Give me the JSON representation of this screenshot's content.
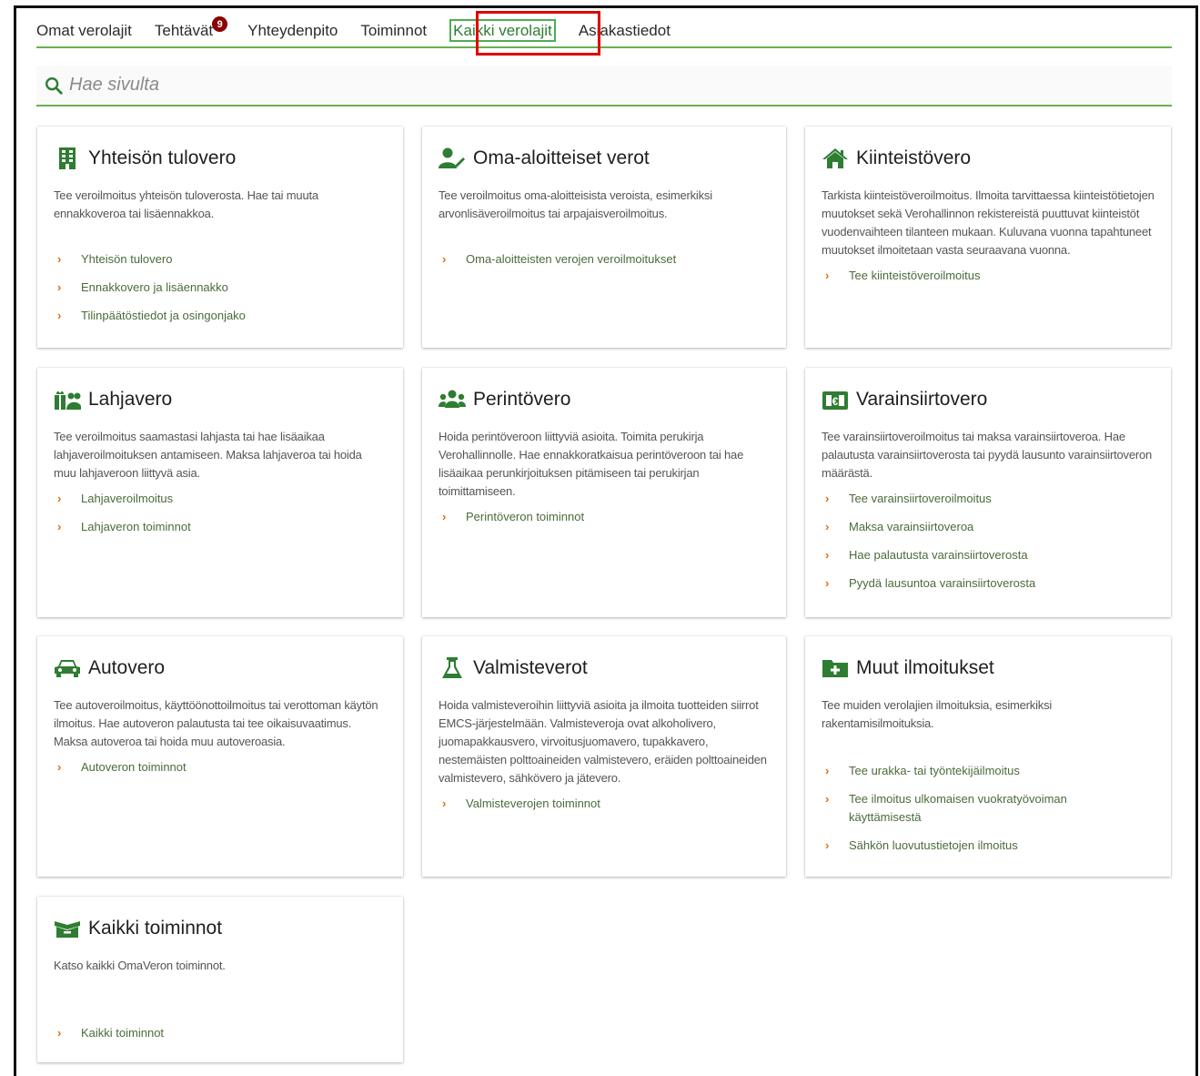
{
  "tabs": [
    {
      "label": "Omat verolajit"
    },
    {
      "label": "Tehtävät",
      "badge": "9"
    },
    {
      "label": "Yhteydenpito"
    },
    {
      "label": "Toiminnot"
    },
    {
      "label": "Kaikki verolajit",
      "active": true
    },
    {
      "label": "Asiakastiedot"
    }
  ],
  "search": {
    "placeholder": "Hae sivulta",
    "icon": "search-icon"
  },
  "colors": {
    "accent": "#6ab04c",
    "link_chevron": "#e06d0c",
    "highlight": "#e00000",
    "icon_green": "#2e7d32"
  },
  "cards": [
    {
      "title": "Yhteisön tulovero",
      "icon": "building-icon",
      "desc": "Tee veroilmoitus yhteisön tuloverosta. Hae tai muuta ennakkoveroa tai lisäennakkoa.",
      "links": [
        "Yhteisön tulovero",
        "Ennakkovero ja lisäennakko",
        "Tilinpäätöstiedot ja osingonjako"
      ]
    },
    {
      "title": "Oma-aloitteiset verot",
      "icon": "user-edit-icon",
      "desc": "Tee veroilmoitus oma-aloitteisista veroista, esimerkiksi arvonlisäveroilmoitus tai arpajaisveroilmoitus.",
      "links": [
        "Oma-aloitteisten verojen veroilmoitukset"
      ]
    },
    {
      "title": "Kiinteistövero",
      "icon": "home-icon",
      "desc": "Tarkista kiinteistöveroilmoitus. Ilmoita tarvittaessa kiinteistötietojen muutokset sekä Verohallinnon rekistereistä puuttuvat kiinteistöt vuodenvaihteen tilanteen mukaan. Kuluvana vuonna tapahtuneet muutokset ilmoitetaan vasta seuraavana vuonna.",
      "links": [
        "Tee kiinteistöveroilmoitus"
      ]
    },
    {
      "title": "Lahjavero",
      "icon": "gift-people-icon",
      "desc": "Tee veroilmoitus saamastasi lahjasta tai hae lisäaikaa lahjaveroilmoituksen antamiseen. Maksa lahjaveroa tai hoida muu lahjaveroon liittyvä asia.",
      "links": [
        "Lahjaveroilmoitus",
        "Lahjaveron toiminnot"
      ]
    },
    {
      "title": "Perintövero",
      "icon": "users-icon",
      "desc": "Hoida perintöveroon liittyviä asioita. Toimita perukirja Verohallinnolle. Hae ennakkoratkaisua perintöveroon tai hae lisäaikaa perunkirjoituksen pitämiseen tai perukirjan toimittamiseen.",
      "links": [
        "Perintöveron toiminnot"
      ]
    },
    {
      "title": "Varainsiirtovero",
      "icon": "transfer-icon",
      "desc": "Tee varainsiirtoveroilmoitus tai maksa varainsiirtoveroa. Hae palautusta varainsiirtoverosta tai pyydä lausunto varainsiirtoveron määrästä.",
      "links": [
        "Tee varainsiirtoveroilmoitus",
        "Maksa varainsiirtoveroa",
        "Hae palautusta varainsiirtoverosta",
        "Pyydä lausuntoa varainsiirtoverosta"
      ]
    },
    {
      "title": "Autovero",
      "icon": "car-icon",
      "desc": "Tee autoveroilmoitus, käyttöönottoilmoitus tai verottoman käytön ilmoitus. Hae autoveron palautusta tai tee oikaisuvaatimus. Maksa autoveroa tai hoida muu autoveroasia.",
      "links": [
        "Autoveron toiminnot"
      ]
    },
    {
      "title": "Valmisteverot",
      "icon": "flask-icon",
      "desc": "Hoida valmisteveroihin liittyviä asioita ja ilmoita tuotteiden siirrot EMCS-järjestelmään. Valmisteveroja ovat alkoholivero, juomapakkausvero, virvoitusjuomavero, tupakkavero, nestemäisten polttoaineiden valmistevero, eräiden polttoaineiden valmistevero, sähkövero ja jätevero.",
      "links": [
        "Valmisteverojen toiminnot"
      ]
    },
    {
      "title": "Muut ilmoitukset",
      "icon": "folder-plus-icon",
      "desc": "Tee muiden verolajien ilmoituksia, esimerkiksi rakentamisilmoituksia.",
      "links": [
        "Tee urakka- tai työntekijäilmoitus",
        "Tee ilmoitus ulkomaisen vuokratyövoiman käyttämisestä",
        "Sähkön luovutustietojen ilmoitus"
      ]
    },
    {
      "title": "Kaikki toiminnot",
      "icon": "box-icon",
      "desc": "Katso kaikki OmaVeron toiminnot.",
      "links": [
        "Kaikki toiminnot"
      ]
    }
  ]
}
